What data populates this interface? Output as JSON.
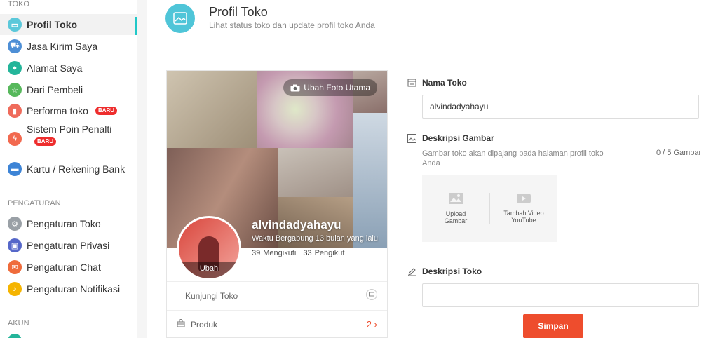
{
  "sidebar": {
    "group_toko": "TOKO",
    "group_pengaturan": "PENGATURAN",
    "group_akun": "AKUN",
    "items": [
      {
        "label": "Profil Toko",
        "icon": "shop-icon",
        "color": "#5bc8da"
      },
      {
        "label": "Jasa Kirim Saya",
        "icon": "truck-icon",
        "color": "#4e8fd6"
      },
      {
        "label": "Alamat Saya",
        "icon": "location-pin-icon",
        "color": "#24b59a"
      },
      {
        "label": "Dari Pembeli",
        "icon": "star-icon",
        "color": "#57b85c"
      },
      {
        "label": "Performa toko",
        "icon": "chart-icon",
        "color": "#ef6b5b",
        "badge": "BARU"
      },
      {
        "label": "Sistem Poin Penalti",
        "icon": "warning-icon",
        "color": "#f2694f",
        "badge": "BARU"
      },
      {
        "label": "Kartu / Rekening Bank",
        "icon": "card-icon",
        "color": "#3d84d6"
      },
      {
        "label": "Pengaturan Toko",
        "icon": "gear-icon",
        "color": "#9aa0a6"
      },
      {
        "label": "Pengaturan Privasi",
        "icon": "lock-icon",
        "color": "#5567c9"
      },
      {
        "label": "Pengaturan Chat",
        "icon": "chat-icon",
        "color": "#ef6b3b"
      },
      {
        "label": "Pengaturan Notifikasi",
        "icon": "bell-icon",
        "color": "#f5b400"
      }
    ]
  },
  "header": {
    "title": "Profil Toko",
    "subtitle": "Lihat status toko dan update profil toko Anda",
    "accent": "#4fc5d8"
  },
  "card": {
    "change_cover": "Ubah Foto Utama",
    "shop_name": "alvindadyahayu",
    "joined": "Waktu Bergabung 13 bulan yang lalu",
    "following_count": "39",
    "following_label": "Mengikuti",
    "followers_count": "33",
    "followers_label": "Pengikut",
    "avatar_label": "Ubah",
    "visit_shop": "Kunjungi Toko",
    "products_label": "Produk",
    "products_count": "2",
    "accent": "#ee4d2d"
  },
  "form": {
    "shop_name_label": "Nama Toko",
    "shop_name_value": "alvindadyahayu",
    "image_desc_label": "Deskripsi Gambar",
    "image_hint": "Gambar toko akan dipajang pada halaman profil toko Anda",
    "image_counter": "0 / 5 Gambar",
    "upload_image": "Upload Gambar",
    "add_video": "Tambah Video YouTube",
    "shop_desc_label": "Deskripsi Toko",
    "shop_desc_value": "",
    "save_label": "Simpan",
    "save_color": "#ee4d2d"
  }
}
